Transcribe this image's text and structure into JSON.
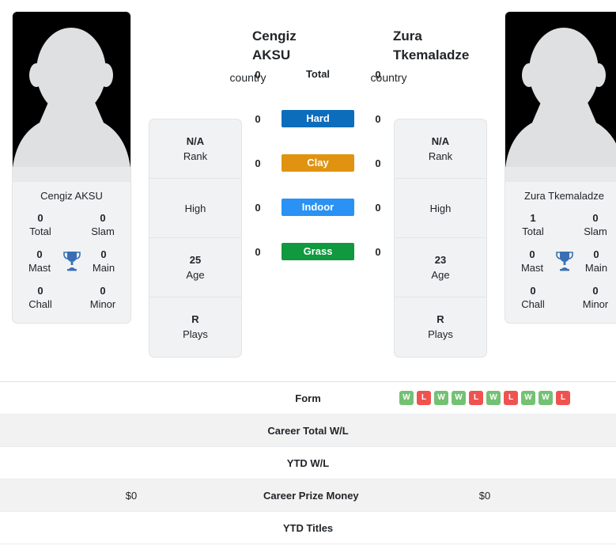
{
  "colors": {
    "hard": "#0d6dbd",
    "clay": "#e09310",
    "indoor": "#2a91f5",
    "grass": "#10993e",
    "win": "#74c174",
    "loss": "#ef5350",
    "trophy": "#3b6fb5",
    "card_bg": "#f1f2f3",
    "stripe": "#f2f2f2"
  },
  "players": {
    "left": {
      "name": "Cengiz AKSU",
      "avatar_caption": "Cengiz AKSU",
      "country_alt": "country",
      "titles": {
        "total": {
          "value": "0",
          "label": "Total"
        },
        "slam": {
          "value": "0",
          "label": "Slam"
        },
        "mast": {
          "value": "0",
          "label": "Mast"
        },
        "main": {
          "value": "0",
          "label": "Main"
        },
        "chall": {
          "value": "0",
          "label": "Chall"
        },
        "minor": {
          "value": "0",
          "label": "Minor"
        }
      },
      "info": [
        {
          "value": "N/A",
          "label": "Rank"
        },
        {
          "value": "",
          "label": "High"
        },
        {
          "value": "25",
          "label": "Age"
        },
        {
          "value": "R",
          "label": "Plays"
        }
      ],
      "surface_scores": {
        "total": "0",
        "hard": "0",
        "clay": "0",
        "indoor": "0",
        "grass": "0"
      },
      "form": [],
      "career_total_wl": "",
      "ytd_wl": "",
      "career_prize_money": "$0",
      "ytd_titles": ""
    },
    "right": {
      "name": "Zura Tkemaladze",
      "avatar_caption": "Zura Tkemaladze",
      "country_alt": "country",
      "titles": {
        "total": {
          "value": "1",
          "label": "Total"
        },
        "slam": {
          "value": "0",
          "label": "Slam"
        },
        "mast": {
          "value": "0",
          "label": "Mast"
        },
        "main": {
          "value": "0",
          "label": "Main"
        },
        "chall": {
          "value": "0",
          "label": "Chall"
        },
        "minor": {
          "value": "0",
          "label": "Minor"
        }
      },
      "info": [
        {
          "value": "N/A",
          "label": "Rank"
        },
        {
          "value": "",
          "label": "High"
        },
        {
          "value": "23",
          "label": "Age"
        },
        {
          "value": "R",
          "label": "Plays"
        }
      ],
      "surface_scores": {
        "total": "0",
        "hard": "0",
        "clay": "0",
        "indoor": "0",
        "grass": "0"
      },
      "form": [
        "W",
        "L",
        "W",
        "W",
        "L",
        "W",
        "L",
        "W",
        "W",
        "L"
      ],
      "career_total_wl": "",
      "ytd_wl": "",
      "career_prize_money": "$0",
      "ytd_titles": ""
    }
  },
  "surfaces": [
    {
      "key": "total",
      "label": "Total",
      "badge": false
    },
    {
      "key": "hard",
      "label": "Hard",
      "badge": true
    },
    {
      "key": "clay",
      "label": "Clay",
      "badge": true
    },
    {
      "key": "indoor",
      "label": "Indoor",
      "badge": true
    },
    {
      "key": "grass",
      "label": "Grass",
      "badge": true
    }
  ],
  "table_rows": [
    {
      "label": "Form",
      "striped": false
    },
    {
      "label": "Career Total W/L",
      "striped": true
    },
    {
      "label": "YTD W/L",
      "striped": false
    },
    {
      "label": "Career Prize Money",
      "striped": true
    },
    {
      "label": "YTD Titles",
      "striped": false
    }
  ]
}
